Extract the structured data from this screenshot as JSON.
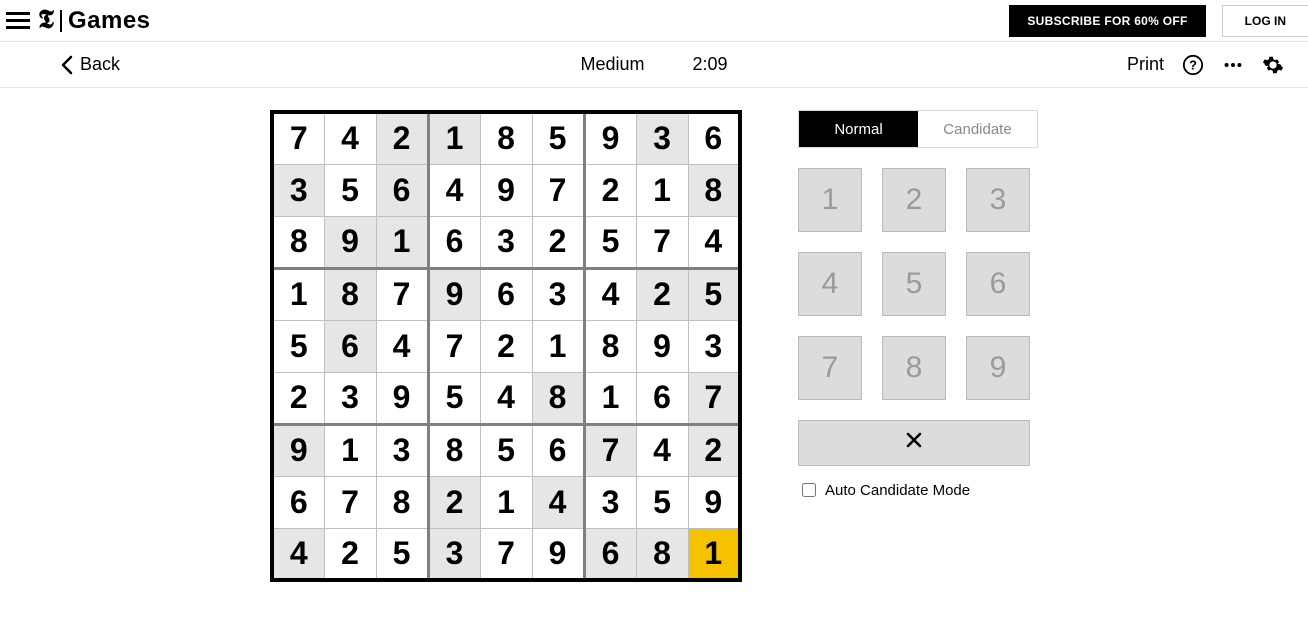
{
  "header": {
    "brand_games": "Games",
    "subscribe": "SUBSCRIBE FOR 60% OFF",
    "login": "LOG IN"
  },
  "toolbar": {
    "back": "Back",
    "difficulty": "Medium",
    "timer": "2:09",
    "print": "Print"
  },
  "mode": {
    "normal": "Normal",
    "candidate": "Candidate",
    "active": "normal"
  },
  "keypad": {
    "keys": [
      "1",
      "2",
      "3",
      "4",
      "5",
      "6",
      "7",
      "8",
      "9"
    ]
  },
  "auto_candidate_label": "Auto Candidate Mode",
  "auto_candidate_checked": false,
  "board": {
    "cells": [
      [
        {
          "v": "7",
          "g": false
        },
        {
          "v": "4",
          "g": false
        },
        {
          "v": "2",
          "g": true
        },
        {
          "v": "1",
          "g": true
        },
        {
          "v": "8",
          "g": false
        },
        {
          "v": "5",
          "g": false
        },
        {
          "v": "9",
          "g": false
        },
        {
          "v": "3",
          "g": true
        },
        {
          "v": "6",
          "g": false
        }
      ],
      [
        {
          "v": "3",
          "g": true
        },
        {
          "v": "5",
          "g": false
        },
        {
          "v": "6",
          "g": true
        },
        {
          "v": "4",
          "g": false
        },
        {
          "v": "9",
          "g": false
        },
        {
          "v": "7",
          "g": false
        },
        {
          "v": "2",
          "g": false
        },
        {
          "v": "1",
          "g": false
        },
        {
          "v": "8",
          "g": true
        }
      ],
      [
        {
          "v": "8",
          "g": false
        },
        {
          "v": "9",
          "g": true
        },
        {
          "v": "1",
          "g": true
        },
        {
          "v": "6",
          "g": false
        },
        {
          "v": "3",
          "g": false
        },
        {
          "v": "2",
          "g": false
        },
        {
          "v": "5",
          "g": false
        },
        {
          "v": "7",
          "g": false
        },
        {
          "v": "4",
          "g": false
        }
      ],
      [
        {
          "v": "1",
          "g": false
        },
        {
          "v": "8",
          "g": true
        },
        {
          "v": "7",
          "g": false
        },
        {
          "v": "9",
          "g": true
        },
        {
          "v": "6",
          "g": false
        },
        {
          "v": "3",
          "g": false
        },
        {
          "v": "4",
          "g": false
        },
        {
          "v": "2",
          "g": true
        },
        {
          "v": "5",
          "g": true
        }
      ],
      [
        {
          "v": "5",
          "g": false
        },
        {
          "v": "6",
          "g": true
        },
        {
          "v": "4",
          "g": false
        },
        {
          "v": "7",
          "g": false
        },
        {
          "v": "2",
          "g": false
        },
        {
          "v": "1",
          "g": false
        },
        {
          "v": "8",
          "g": false
        },
        {
          "v": "9",
          "g": false
        },
        {
          "v": "3",
          "g": false
        }
      ],
      [
        {
          "v": "2",
          "g": false
        },
        {
          "v": "3",
          "g": false
        },
        {
          "v": "9",
          "g": false
        },
        {
          "v": "5",
          "g": false
        },
        {
          "v": "4",
          "g": false
        },
        {
          "v": "8",
          "g": true
        },
        {
          "v": "1",
          "g": false
        },
        {
          "v": "6",
          "g": false
        },
        {
          "v": "7",
          "g": true
        }
      ],
      [
        {
          "v": "9",
          "g": true
        },
        {
          "v": "1",
          "g": false
        },
        {
          "v": "3",
          "g": false
        },
        {
          "v": "8",
          "g": false
        },
        {
          "v": "5",
          "g": false
        },
        {
          "v": "6",
          "g": false
        },
        {
          "v": "7",
          "g": true
        },
        {
          "v": "4",
          "g": false
        },
        {
          "v": "2",
          "g": true
        }
      ],
      [
        {
          "v": "6",
          "g": false
        },
        {
          "v": "7",
          "g": false
        },
        {
          "v": "8",
          "g": false
        },
        {
          "v": "2",
          "g": true
        },
        {
          "v": "1",
          "g": false
        },
        {
          "v": "4",
          "g": true
        },
        {
          "v": "3",
          "g": false
        },
        {
          "v": "5",
          "g": false
        },
        {
          "v": "9",
          "g": false
        }
      ],
      [
        {
          "v": "4",
          "g": true
        },
        {
          "v": "2",
          "g": false
        },
        {
          "v": "5",
          "g": false
        },
        {
          "v": "3",
          "g": true
        },
        {
          "v": "7",
          "g": false
        },
        {
          "v": "9",
          "g": false
        },
        {
          "v": "6",
          "g": true
        },
        {
          "v": "8",
          "g": true
        },
        {
          "v": "1",
          "g": false,
          "sel": true
        }
      ]
    ]
  }
}
